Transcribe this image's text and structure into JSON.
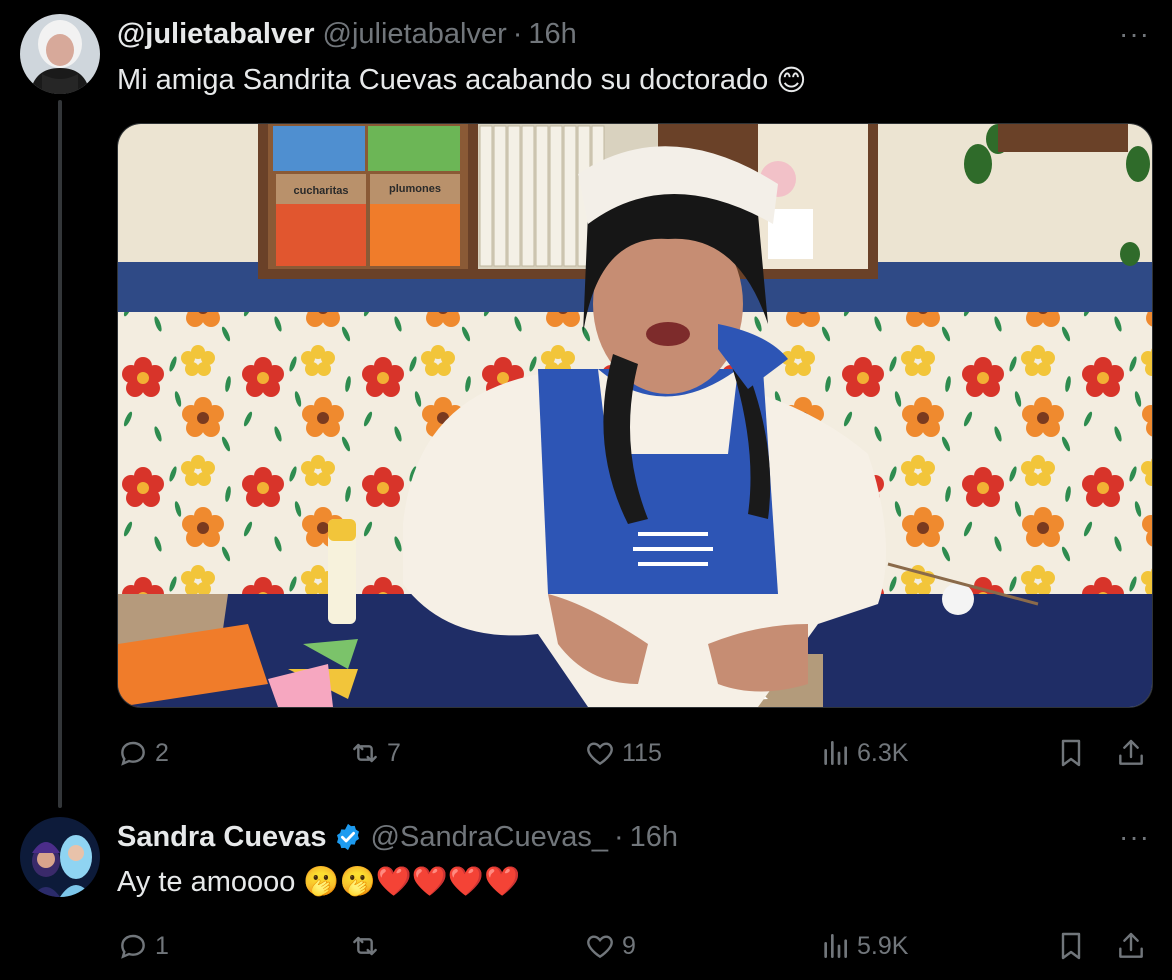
{
  "tweet1": {
    "name": "@julietabalver",
    "handle": "@julietabalver",
    "separator": "·",
    "time": "16h",
    "more": "···",
    "text": "Mi amiga Sandrita Cuevas acabando su doctorado",
    "emoji": "😊",
    "media": {
      "label_box1": "cucharitas",
      "label_box2": "plumones"
    },
    "actions": {
      "replies": "2",
      "reposts": "7",
      "likes": "115",
      "views": "6.3K"
    }
  },
  "tweet2": {
    "name": "Sandra Cuevas",
    "handle": "@SandraCuevas_",
    "separator": "·",
    "time": "16h",
    "more": "···",
    "text": "Ay te amoooo",
    "emojis": "🫢🫢❤️❤️❤️❤️",
    "actions": {
      "replies": "1",
      "reposts": "",
      "likes": "9",
      "views": "5.9K"
    }
  },
  "colors": {
    "background": "#000000",
    "text": "#e7e9ea",
    "muted": "#71767b",
    "verified": "#1d9bf0"
  }
}
